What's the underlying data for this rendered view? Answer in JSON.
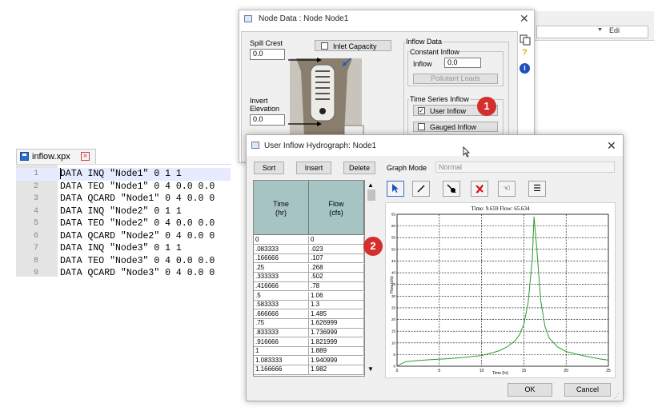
{
  "editor": {
    "tab_name": "inflow.xpx",
    "lines": [
      {
        "n": "1",
        "text": "DATA INQ \"Node1\" 0 1 1"
      },
      {
        "n": "2",
        "text": "DATA TEO \"Node1\" 0 4 0.0 0.0"
      },
      {
        "n": "3",
        "text": "DATA QCARD \"Node1\" 0 4 0.0 0"
      },
      {
        "n": "4",
        "text": "DATA INQ \"Node2\" 0 1 1"
      },
      {
        "n": "5",
        "text": "DATA TEO \"Node2\" 0 4 0.0 0.0"
      },
      {
        "n": "6",
        "text": "DATA QCARD \"Node2\" 0 4 0.0 0"
      },
      {
        "n": "7",
        "text": "DATA INQ \"Node3\" 0 1 1"
      },
      {
        "n": "8",
        "text": "DATA TEO \"Node3\" 0 4 0.0 0.0"
      },
      {
        "n": "9",
        "text": "DATA QCARD \"Node3\" 0 4 0.0 0"
      }
    ]
  },
  "background_window": {
    "label": "Edi"
  },
  "node_window": {
    "title": "Node Data : Node Node1",
    "spill_crest_label": "Spill Crest",
    "spill_crest_value": "0.0",
    "inlet_capacity_label": "Inlet Capacity",
    "invert_label_1": "Invert",
    "invert_label_2": "Elevation",
    "invert_value": "0.0",
    "inflow_data_label": "Inflow Data",
    "constant_inflow_label": "Constant Inflow",
    "inflow_label": "Inflow",
    "inflow_value": "0.0",
    "pollutant_loads_label": "Pollutant Loads",
    "time_series_label": "Time Series Inflow",
    "user_inflow_label": "User Inflow",
    "gauged_inflow_label": "Gauged Inflow"
  },
  "badges": {
    "one": "1",
    "two": "2"
  },
  "hydro_window": {
    "title": "User Inflow Hydrograph: Node1",
    "sort_label": "Sort",
    "insert_label": "Insert",
    "delete_label": "Delete",
    "graph_mode_label": "Graph Mode",
    "graph_mode_value": "Normal",
    "col_time_1": "Time",
    "col_time_2": "(hr)",
    "col_flow_1": "Flow",
    "col_flow_2": "(cfs)",
    "rows": [
      [
        "0",
        "0"
      ],
      [
        ".083333",
        ".023"
      ],
      [
        ".166666",
        ".107"
      ],
      [
        ".25",
        ".268"
      ],
      [
        ".333333",
        ".502"
      ],
      [
        ".416666",
        ".78"
      ],
      [
        ".5",
        "1.06"
      ],
      [
        ".583333",
        "1.3"
      ],
      [
        ".666666",
        "1.485"
      ],
      [
        ".75",
        "1.626999"
      ],
      [
        ".833333",
        "1.736999"
      ],
      [
        ".916666",
        "1.821999"
      ],
      [
        "1",
        "1.889"
      ],
      [
        "1.083333",
        "1.940999"
      ],
      [
        "1.166666",
        "1.982"
      ]
    ],
    "ok_label": "OK",
    "cancel_label": "Cancel"
  },
  "chart_data": {
    "type": "line",
    "title": "Time: 9.659 Flow: 65.634",
    "xlabel": "Time (hr)",
    "ylabel": "Flow (cfs)",
    "xlim": [
      0,
      25
    ],
    "ylim": [
      0,
      65
    ],
    "xticks": [
      0,
      5,
      10,
      15,
      20,
      25
    ],
    "yticks": [
      0,
      5,
      10,
      15,
      20,
      25,
      30,
      35,
      40,
      45,
      50,
      55,
      60,
      65
    ],
    "grid": true,
    "line_color": "#2e9a2e",
    "series": [
      {
        "x": [
          0,
          0.5,
          1,
          2,
          4,
          6,
          8,
          10,
          11,
          12,
          13,
          14,
          14.5,
          15,
          15.5,
          16,
          16.2,
          16.5,
          17,
          17.5,
          18,
          19,
          20,
          22,
          24,
          25
        ],
        "values": [
          0,
          1.06,
          1.9,
          2.3,
          2.8,
          3.2,
          3.8,
          4.6,
          5.5,
          6.5,
          8.2,
          11,
          13.5,
          18,
          27,
          46,
          64,
          52,
          28,
          17,
          12,
          8.2,
          6.3,
          4.5,
          3.1,
          2.6
        ]
      }
    ]
  }
}
